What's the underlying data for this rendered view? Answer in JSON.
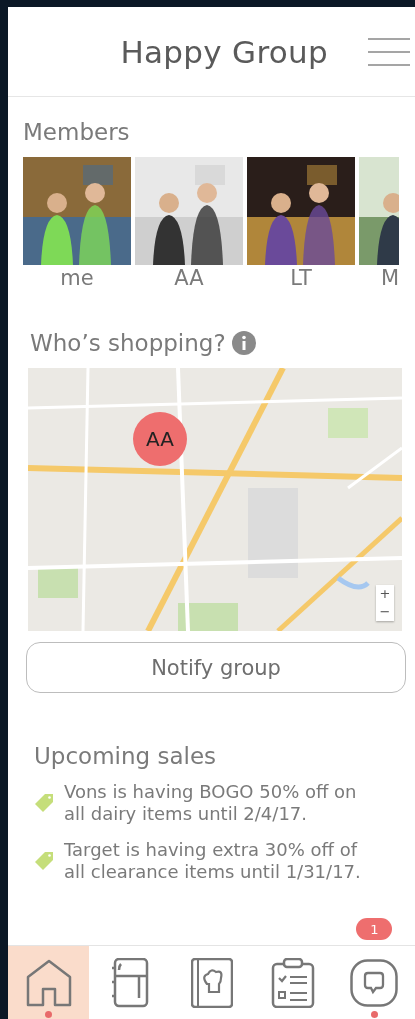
{
  "header": {
    "title": "Happy Group"
  },
  "members": {
    "heading": "Members",
    "items": [
      {
        "name": "me",
        "kind": "picture"
      },
      {
        "name": "AA",
        "kind": "picture"
      },
      {
        "name": "LT",
        "kind": "picture"
      },
      {
        "name": "M",
        "kind": "picture"
      }
    ]
  },
  "shopping": {
    "heading": "Who’s shopping?",
    "map": {
      "kind": "picture",
      "marker": "AA",
      "zoom_in": "+",
      "zoom_out": "−"
    },
    "button": "Notify group"
  },
  "sales": {
    "heading": "Upcoming sales",
    "items": [
      {
        "text": "Vons is having BOGO 50% off on all dairy items until 2/4/17."
      },
      {
        "text": "Target is having extra 30% off of all clearance items until 1/31/17."
      }
    ]
  },
  "nav": {
    "badge": "1",
    "items": [
      {
        "kind": "home",
        "selected": true,
        "dot": true
      },
      {
        "kind": "fridge",
        "selected": false,
        "dot": false
      },
      {
        "kind": "recipes",
        "selected": false,
        "dot": false
      },
      {
        "kind": "checklist",
        "selected": false,
        "dot": false
      },
      {
        "kind": "chat",
        "selected": false,
        "dot": true
      }
    ]
  }
}
